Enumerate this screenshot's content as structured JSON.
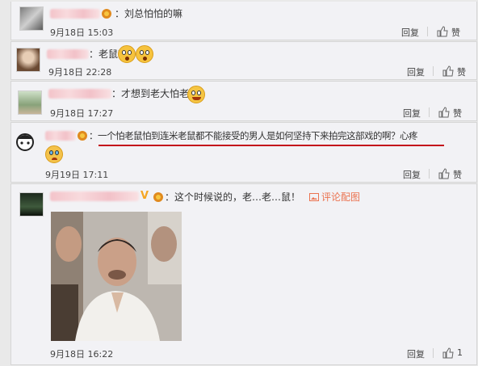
{
  "comments": [
    {
      "text": "：刘总怕怕的嘛",
      "time": "9月18日 15:03",
      "reply": "回复",
      "like": "赞"
    },
    {
      "text": "：老鼠？",
      "time": "9月18日 22:28",
      "reply": "回复",
      "like": "赞"
    },
    {
      "text": "：才想到老大怕老鼠",
      "time": "9月18日 17:27",
      "reply": "回复",
      "like": "赞"
    },
    {
      "text": "：一个怕老鼠怕到连米老鼠都不能接受的男人是如何坚持下来拍完这部戏的啊？心疼",
      "time": "9月19日 17:11",
      "reply": "回复",
      "like": "赞"
    },
    {
      "text": "：这个时候说的，老…老…鼠！",
      "pic_link": "评论配图",
      "time": "9月18日 16:22",
      "reply": "回复",
      "like_count": "1"
    }
  ],
  "colors": {
    "underline": "#c4141b",
    "link": "#eb7350",
    "vip": "#f5a623"
  }
}
